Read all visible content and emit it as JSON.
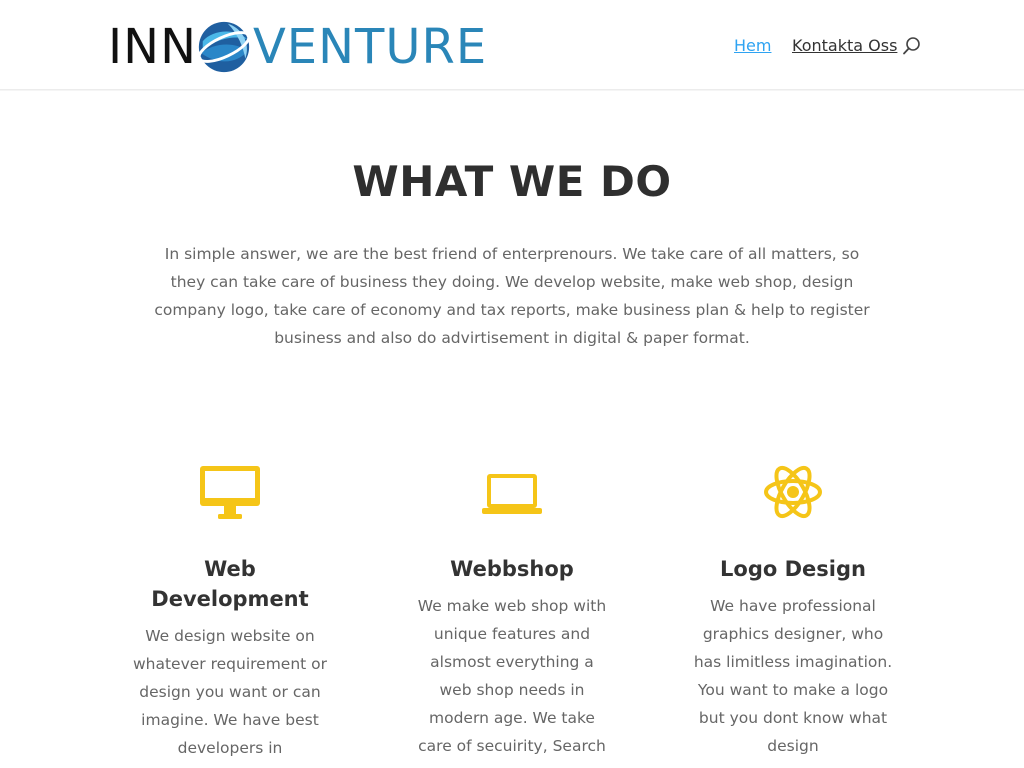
{
  "header": {
    "logo": {
      "part1": "INN",
      "part2": "VENTURE"
    },
    "nav": [
      {
        "label": "Hem",
        "active": true
      },
      {
        "label": "Kontakta Oss",
        "active": false
      }
    ],
    "search_icon": "search-icon"
  },
  "section": {
    "title": "WHAT WE DO",
    "intro": "In simple answer, we are the best friend of enterprenours. We take care of all matters, so they can take care of business they doing. We develop website, make web shop, design company logo, take care of economy and tax reports,  make business plan & help to register business and also do advirtisement in digital & paper format."
  },
  "services": [
    {
      "icon": "desktop-monitor-icon",
      "title": "Web Development",
      "text": "We design website on whatever requirement or design you want or can imagine. We have best developers in"
    },
    {
      "icon": "laptop-icon",
      "title": "Webbshop",
      "text": "We make web shop with unique features and alsmost everything a web shop needs in modern age. We take care of secuirity, Search"
    },
    {
      "icon": "atom-icon",
      "title": "Logo Design",
      "text": "We have professional graphics designer, who has limitless imagination. You want to make a logo but you dont know what design"
    }
  ],
  "colors": {
    "accent": "#2ea3f2",
    "icon": "#f5c518",
    "logo_blue": "#2a86b8",
    "heading": "#333333",
    "body_text": "#666666"
  }
}
